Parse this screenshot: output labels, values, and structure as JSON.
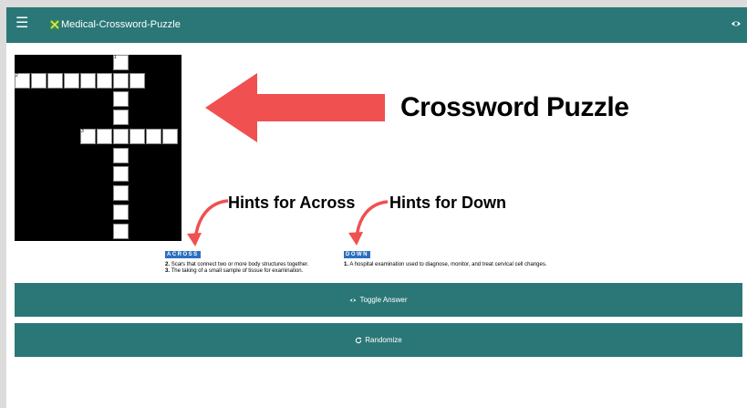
{
  "app": {
    "title": "Medical-Crossword-Puzzle",
    "menu_icon": "hamburger-menu-icon",
    "logo_icon": "puzzle-logo-icon",
    "right_icon": "eye-icon",
    "accent_color": "#2b7777"
  },
  "puzzle": {
    "numbers": [
      "1",
      "2",
      "3"
    ]
  },
  "hints": {
    "across_title": "ACROSS",
    "down_title": "DOWN",
    "across": [
      {
        "num": "2.",
        "text": "Scars that connect two or more body structures together."
      },
      {
        "num": "3.",
        "text": "The taking of a small sample of tissue for examination."
      }
    ],
    "down": [
      {
        "num": "1.",
        "text": "A hospital examination used to diagnose, monitor, and treat cervical cell changes."
      }
    ],
    "header_color": "#2d6fc0"
  },
  "buttons": {
    "toggle_answer": "Toggle Answer",
    "randomize": "Randomize"
  },
  "annotations": {
    "crossword": "Crossword Puzzle",
    "across": "Hints for Across",
    "down": "Hints for Down",
    "arrow_color": "#f05050"
  }
}
